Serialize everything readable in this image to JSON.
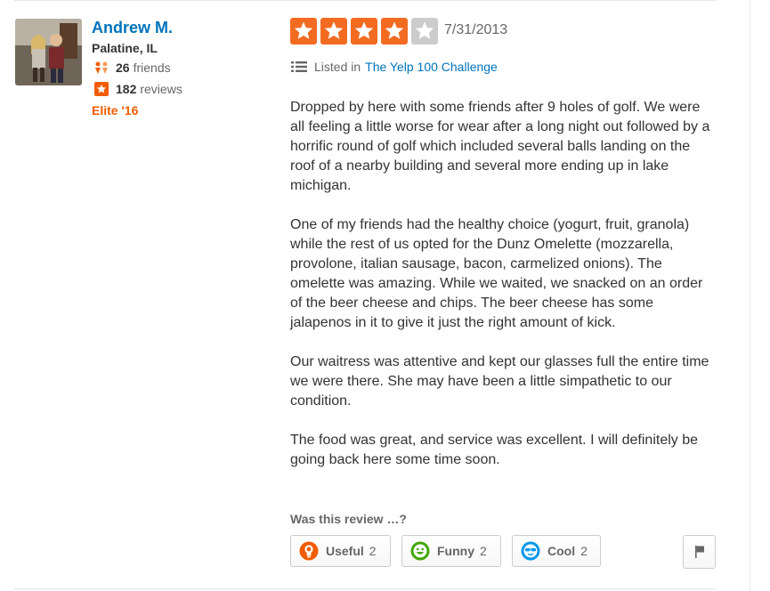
{
  "user": {
    "name": "Andrew M.",
    "location": "Palatine, IL",
    "friends_count": "26",
    "friends_label": "friends",
    "reviews_count": "182",
    "reviews_label": "reviews",
    "elite_badge": "Elite '16",
    "avatar_icon": "user-photo"
  },
  "review": {
    "rating": 4,
    "rating_max": 5,
    "date": "7/31/2013",
    "listed_prefix": "Listed in",
    "listed_link": "The Yelp 100 Challenge",
    "paragraphs": [
      "Dropped by here with some friends after 9 holes of golf. We were all feeling a little worse for wear after a long night out followed by a horrific round of golf which included several balls landing on the roof of a nearby building and several more ending up in lake michigan.",
      "One of my friends had the healthy choice (yogurt, fruit, granola) while the rest of us opted for the Dunz Omelette (mozzarella, provolone, italian sausage, bacon, carmelized onions). The omelette was amazing. While we waited, we snacked on an order of the beer cheese and chips. The beer cheese has some jalapenos in it to give it just the right amount of kick.",
      "Our waitress was attentive and kept our glasses full the entire time we were there. She may have been a little simpathetic to our condition.",
      "The food was great, and service was excellent. I will definitely be going back here some time soon."
    ]
  },
  "votes": {
    "prompt": "Was this review …?",
    "useful": {
      "label": "Useful",
      "count": "2",
      "icon": "lightbulb-icon"
    },
    "funny": {
      "label": "Funny",
      "count": "2",
      "icon": "smiley-icon"
    },
    "cool": {
      "label": "Cool",
      "count": "2",
      "icon": "sunglasses-icon"
    }
  },
  "colors": {
    "link_blue": "#0073bb",
    "elite_orange": "#f15c00",
    "star_filled": "#f26b21",
    "star_empty": "#cccccc"
  }
}
